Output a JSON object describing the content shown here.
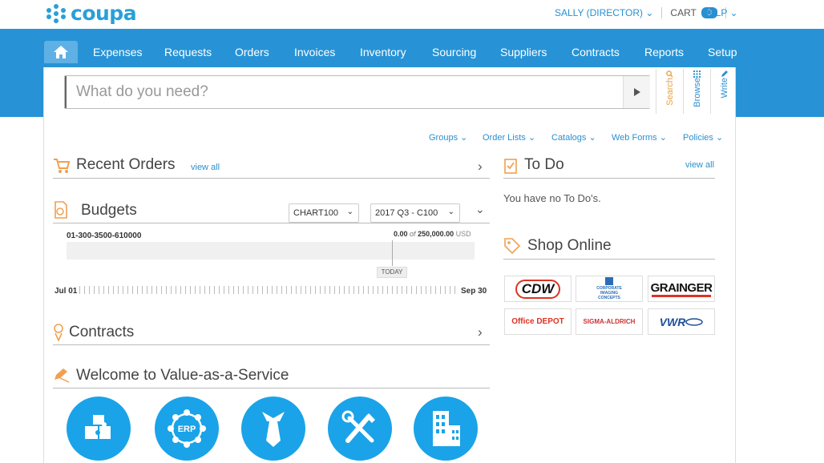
{
  "header": {
    "logo_text": "coupa",
    "user_menu": "SALLY (DIRECTOR) ⌄",
    "cart_label": "CART",
    "cart_count": "0",
    "help_label": "HELP ⌄"
  },
  "nav": {
    "items": [
      "Expenses",
      "Requests",
      "Orders",
      "Invoices",
      "Inventory",
      "Sourcing",
      "Suppliers",
      "Contracts",
      "Reports",
      "Setup"
    ]
  },
  "search": {
    "placeholder": "What do you need?",
    "tabs": [
      "Search",
      "Browse",
      "Write"
    ]
  },
  "subnav": {
    "items": [
      "Groups ⌄",
      "Order Lists ⌄",
      "Catalogs ⌄",
      "Web Forms ⌄",
      "Policies ⌄"
    ]
  },
  "recent_orders": {
    "title": "Recent Orders",
    "view_all": "view all"
  },
  "budgets": {
    "title": "Budgets",
    "chart_select": "CHART100",
    "period_select": "2017 Q3 - C100",
    "account": "01-300-3500-610000",
    "spent": "0.00",
    "of": "of",
    "total": "250,000.00",
    "currency": "USD",
    "today": "TODAY",
    "start": "Jul 01",
    "end": "Sep 30",
    "used_fraction": 0
  },
  "contracts": {
    "title": "Contracts"
  },
  "welcome": {
    "title": "Welcome to Value-as-a-Service",
    "erp_label": "ERP"
  },
  "todo": {
    "title": "To Do",
    "view_all": "view all",
    "empty": "You have no To Do's."
  },
  "shop": {
    "title": "Shop Online",
    "suppliers": [
      "CDW",
      "CORPORATE IMAGING CONCEPTS",
      "GRAINGER",
      "Office DEPOT",
      "SIGMA-ALDRICH",
      "VWR"
    ]
  },
  "colors": {
    "brand_blue": "#2793d6",
    "link": "#2a8fd0",
    "circle": "#1aa3e8",
    "accent_orange": "#e8a040"
  }
}
